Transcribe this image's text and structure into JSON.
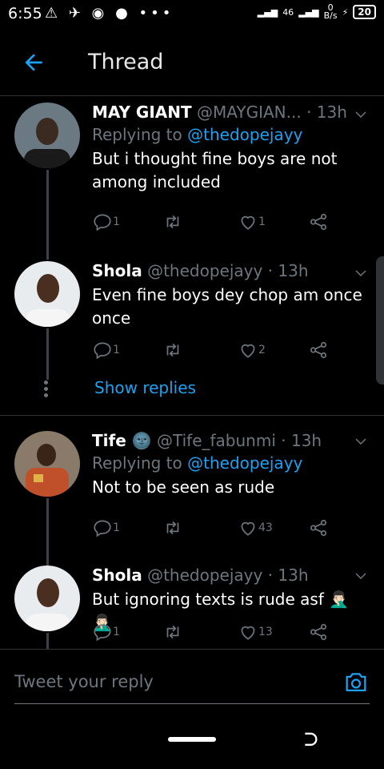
{
  "status_bar": {
    "time": "6:55",
    "network": "46",
    "speed_top": "0",
    "speed_unit": "B/s",
    "battery": "20"
  },
  "header": {
    "title": "Thread"
  },
  "tweets": [
    {
      "name": "MAY GIANT",
      "handle": "@MAYGIAN...",
      "time": "13h",
      "reply_to_prefix": "Replying to",
      "reply_to": "@thedopejayy",
      "text": "But i thought fine boys are not among included",
      "replies": "1",
      "retweets": "",
      "likes": "1"
    },
    {
      "name": "Shola",
      "handle": "@thedopejayy",
      "time": "13h",
      "text": "Even fine boys dey chop am once once",
      "replies": "1",
      "retweets": "",
      "likes": "2"
    },
    {
      "name": "Tife 🌚",
      "handle": "@Tife_fabunmi",
      "time": "13h",
      "reply_to_prefix": "Replying to",
      "reply_to": "@thedopejayy",
      "text": "Not to be seen as rude",
      "replies": "1",
      "retweets": "",
      "likes": "43"
    },
    {
      "name": "Shola",
      "handle": "@thedopejayy",
      "time": "13h",
      "text": "But ignoring texts is rude asf 🤦🏻‍♂️🤦🏻‍♂️",
      "replies": "1",
      "retweets": "",
      "likes": "13"
    }
  ],
  "show_replies": "Show replies",
  "reply_box": {
    "placeholder": "Tweet your reply"
  },
  "colors": {
    "accent": "#1da1f2",
    "muted": "#6e767d",
    "background": "#000000"
  }
}
